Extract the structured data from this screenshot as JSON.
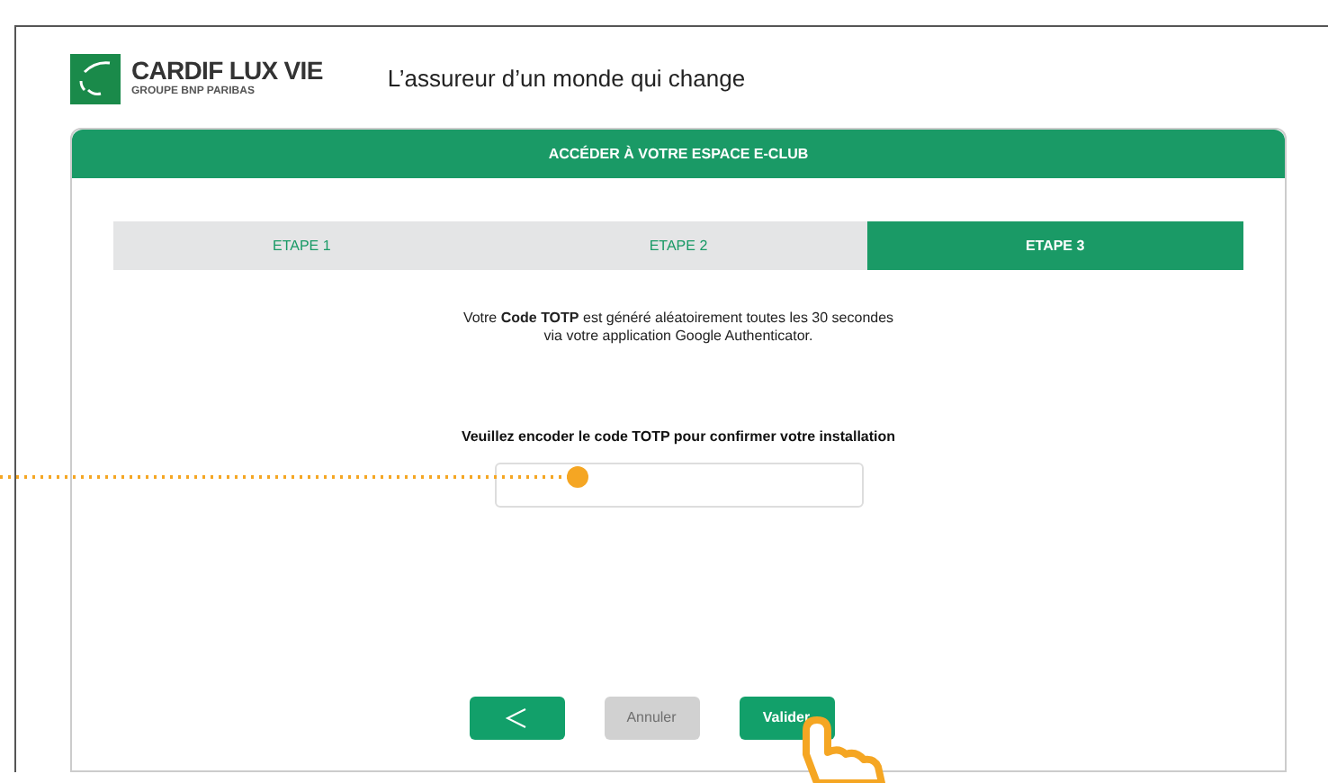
{
  "header": {
    "brand": "CARDIF LUX VIE",
    "brand_sub": "GROUPE BNP PARIBAS",
    "tagline": "L’assureur d’un monde qui change"
  },
  "panel": {
    "title": "ACCÉDER À VOTRE ESPACE E-CLUB"
  },
  "steps": [
    {
      "label": "ETAPE 1",
      "selected": false
    },
    {
      "label": "ETAPE 2",
      "selected": false
    },
    {
      "label": "ETAPE 3",
      "selected": true
    }
  ],
  "intro": [
    "Votre **Code TOTP** est généré aléatoirement toutes les 30 secondes",
    "via votre application Google Authenticator."
  ],
  "code_field": {
    "label": "Veuillez encoder le code TOTP pour confirmer votre installation"
  },
  "buttons": [
    {
      "kind": "back",
      "disabled": false
    },
    {
      "kind": "text",
      "label": "Annuler",
      "disabled": true
    },
    {
      "kind": "text",
      "label": "Valider",
      "disabled": false
    }
  ]
}
